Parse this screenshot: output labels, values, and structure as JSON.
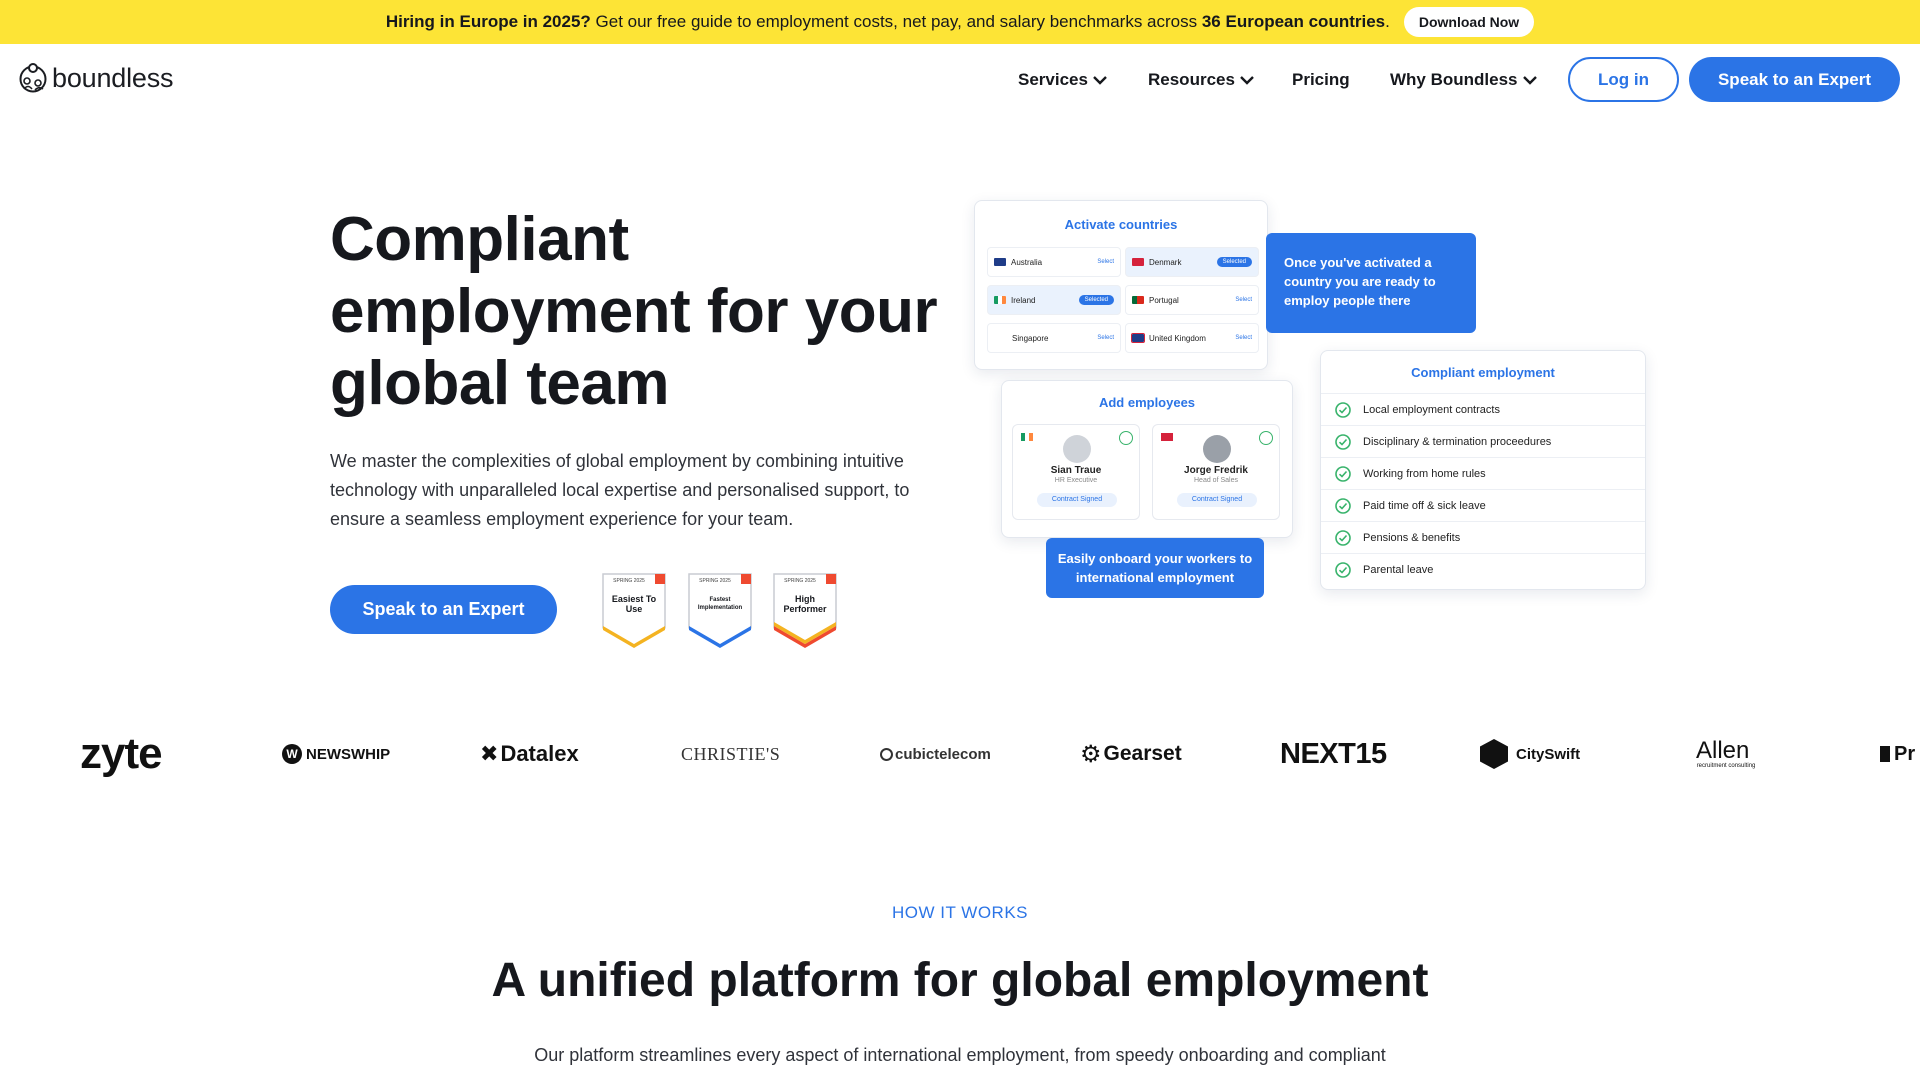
{
  "banner": {
    "bold_lead": "Hiring in Europe in 2025?",
    "text": " Get our free guide to employment costs, net pay, and salary benchmarks across ",
    "bold_count": "36 European countries",
    "period": ".",
    "button": "Download Now",
    "bg_color": "#fde436"
  },
  "nav": {
    "logo_text": "boundless",
    "items": [
      {
        "label": "Services",
        "icon": "chevron-down-icon"
      },
      {
        "label": "Resources",
        "icon": "chevron-down-icon"
      },
      {
        "label": "Pricing"
      },
      {
        "label": "Why Boundless",
        "icon": "chevron-down-icon"
      }
    ],
    "login": "Log in",
    "cta": "Speak to an Expert",
    "accent_color": "#2b74e6"
  },
  "hero": {
    "title": "Compliant employment for your global team",
    "description": "We master the complexities of global employment by combining intuitive technology with unparalleled local expertise and personalised support, to ensure a seamless employment experience for your team.",
    "cta": "Speak to an Expert",
    "badges": [
      {
        "season": "SPRING 2025",
        "label": "Easiest To Use",
        "icon": "g2-icon"
      },
      {
        "season": "SPRING 2025",
        "label": "Fastest Implementation",
        "icon": "g2-icon"
      },
      {
        "season": "SPRING 2025",
        "label": "High Performer",
        "icon": "g2-icon"
      }
    ]
  },
  "illustration": {
    "activate": {
      "title": "Activate countries",
      "countries": [
        {
          "name": "Australia",
          "status": "Select"
        },
        {
          "name": "Denmark",
          "status": "Selected"
        },
        {
          "name": "Ireland",
          "status": "Selected"
        },
        {
          "name": "Portugal",
          "status": "Select"
        },
        {
          "name": "Singapore",
          "status": "Select"
        },
        {
          "name": "United Kingdom",
          "status": "Select"
        }
      ]
    },
    "activated_note": "Once you've activated a country you are ready to employ people there",
    "add_employees": {
      "title": "Add employees",
      "employees": [
        {
          "name": "Sian Traue",
          "role": "HR Executive",
          "status": "Contract Signed"
        },
        {
          "name": "Jorge Fredrik",
          "role": "Head of Sales",
          "status": "Contract Signed"
        }
      ]
    },
    "onboard_note": "Easily onboard your workers to international employment",
    "compliant": {
      "title": "Compliant employment",
      "items": [
        "Local employment contracts",
        "Disciplinary & termination proceedures",
        "Working from home rules",
        "Paid time off & sick leave",
        "Pensions & benefits",
        "Parental leave"
      ]
    }
  },
  "client_logos": [
    "zyte",
    "NEWSWHIP",
    "Datalex",
    "CHRISTIE'S",
    "cubictelecom",
    "Gearset",
    "NEXT15",
    "CitySwift",
    "Allen",
    "recruitment consulting",
    "Pr"
  ],
  "how_it_works": {
    "eyebrow": "HOW IT WORKS",
    "title": "A unified platform for global employment",
    "subtitle": "Our platform streamlines every aspect of international employment, from speedy onboarding and compliant"
  }
}
